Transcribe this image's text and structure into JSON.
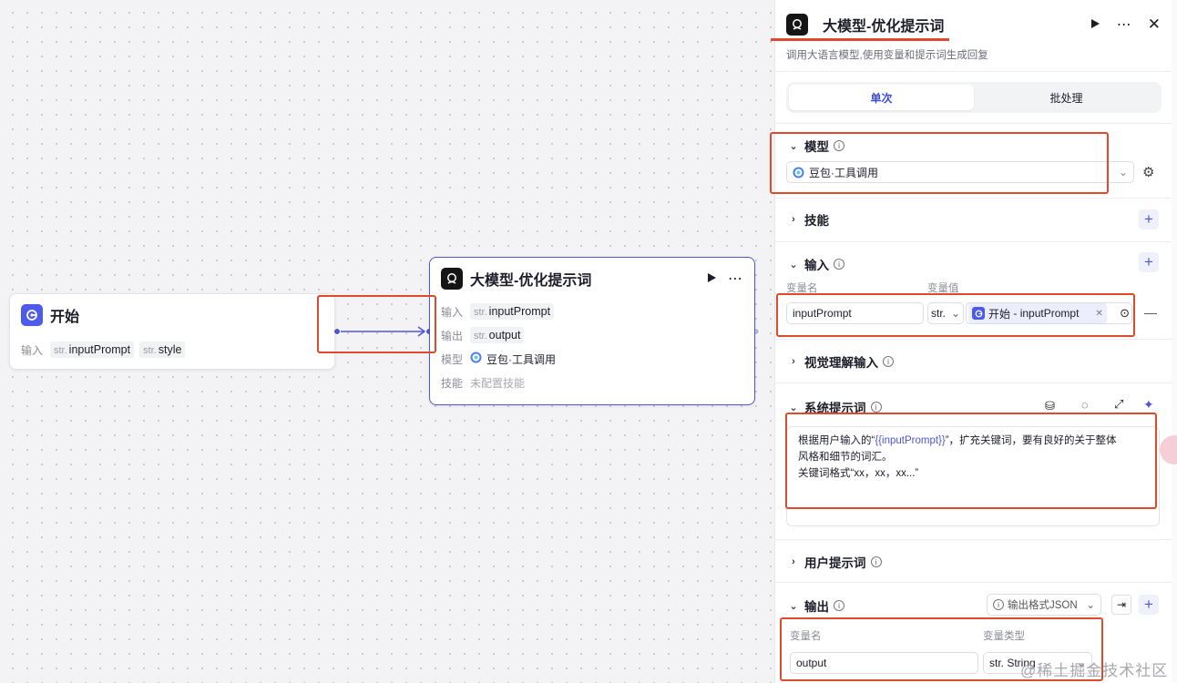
{
  "canvas": {
    "start_node": {
      "title": "开始",
      "input_label": "输入",
      "params": [
        {
          "type": "str.",
          "name": "inputPrompt"
        },
        {
          "type": "str.",
          "name": "style"
        }
      ]
    },
    "llm_node": {
      "title": "大模型-优化提示词",
      "rows": {
        "input_label": "输入",
        "input_type": "str.",
        "input_name": "inputPrompt",
        "output_label": "输出",
        "output_type": "str.",
        "output_name": "output",
        "model_label": "模型",
        "model_name": "豆包·工具调用",
        "skill_label": "技能",
        "skill_value": "未配置技能"
      }
    }
  },
  "panel": {
    "title": "大模型-优化提示词",
    "description": "调用大语言模型,使用变量和提示词生成回复",
    "tabs": [
      {
        "label": "单次",
        "active": true
      },
      {
        "label": "批处理",
        "active": false
      }
    ],
    "model_section": {
      "label": "模型",
      "selected": "豆包·工具调用"
    },
    "skills_section": {
      "label": "技能"
    },
    "input_section": {
      "label": "输入",
      "col_name": "变量名",
      "col_value": "变量值",
      "var_name": "inputPrompt",
      "var_type": "str.",
      "ref_node": "开始",
      "ref_sep": "-",
      "ref_var": "inputPrompt"
    },
    "vision_section": {
      "label": "视觉理解输入"
    },
    "system_prompt": {
      "label": "系统提示词",
      "line1_pre": "根据用户输入的“",
      "line1_var": "{{inputPrompt}}",
      "line1_post": "”，扩充关键词，要有良好的关于整体",
      "line2": "风格和细节的词汇。",
      "line3": "关键词格式“xx，xx，xx...”"
    },
    "user_prompt": {
      "label": "用户提示词"
    },
    "output_section": {
      "label": "输出",
      "format_label": "输出格式JSON",
      "col_name": "变量名",
      "col_type": "变量类型",
      "var_name": "output",
      "var_type": "str. String"
    }
  },
  "watermark": "@稀土掘金技术社区",
  "colors": {
    "accent": "#4e57d6",
    "highlight": "#e04a2c"
  }
}
